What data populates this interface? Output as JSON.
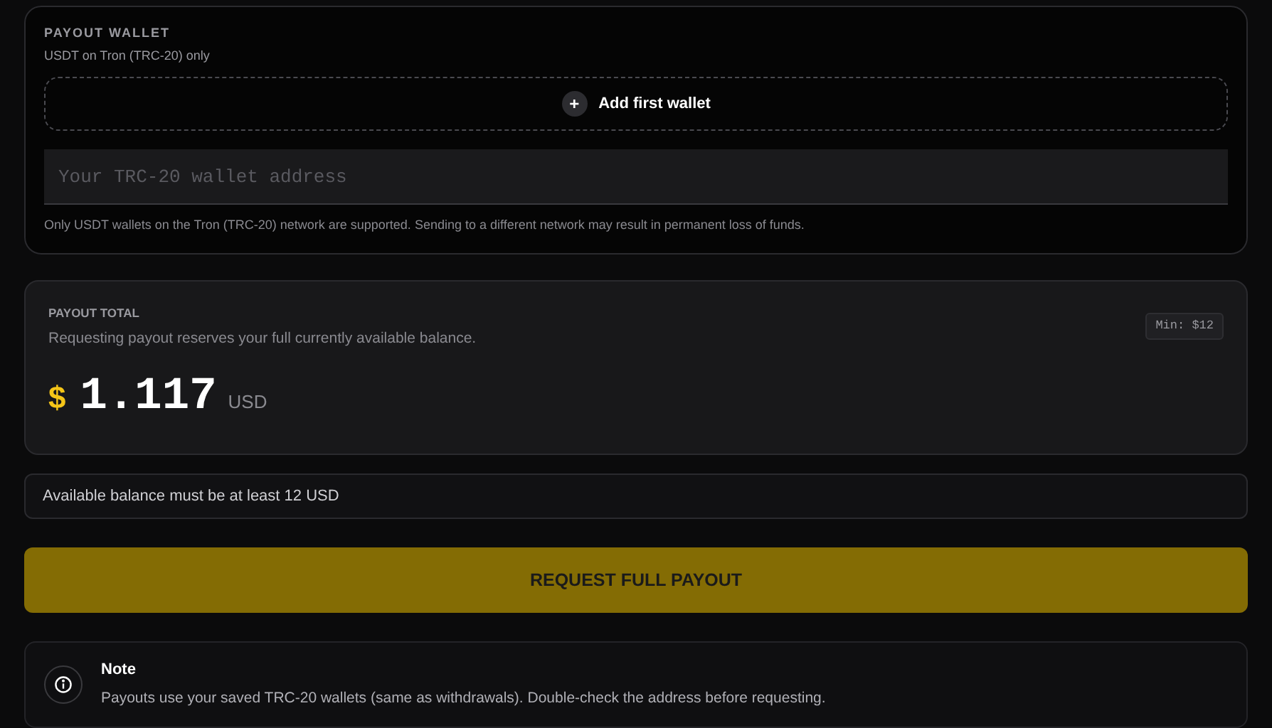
{
  "payout_wallet": {
    "title": "PAYOUT WALLET",
    "subtitle": "USDT on Tron (TRC-20) only",
    "add_button": {
      "icon": "+",
      "label": "Add first wallet"
    },
    "address_field": {
      "placeholder": "Your TRC-20 wallet address"
    },
    "hint": "Only USDT wallets on the Tron (TRC-20) network are supported. Sending to a different network may result in permanent loss of funds."
  },
  "payout_total": {
    "title": "PAYOUT TOTAL",
    "description": "Requesting payout reserves your full currently available balance.",
    "min_badge": "Min: $12",
    "currency_symbol": "$",
    "amount": "1.117",
    "currency": "USD"
  },
  "balance_notice": "Available balance must be at least 12 USD",
  "request_button": {
    "label": "REQUEST FULL PAYOUT",
    "disabled": true
  },
  "note": {
    "title": "Note",
    "text": "Payouts use your saved TRC-20 wallets (same as withdrawals). Double-check the address before requesting."
  }
}
